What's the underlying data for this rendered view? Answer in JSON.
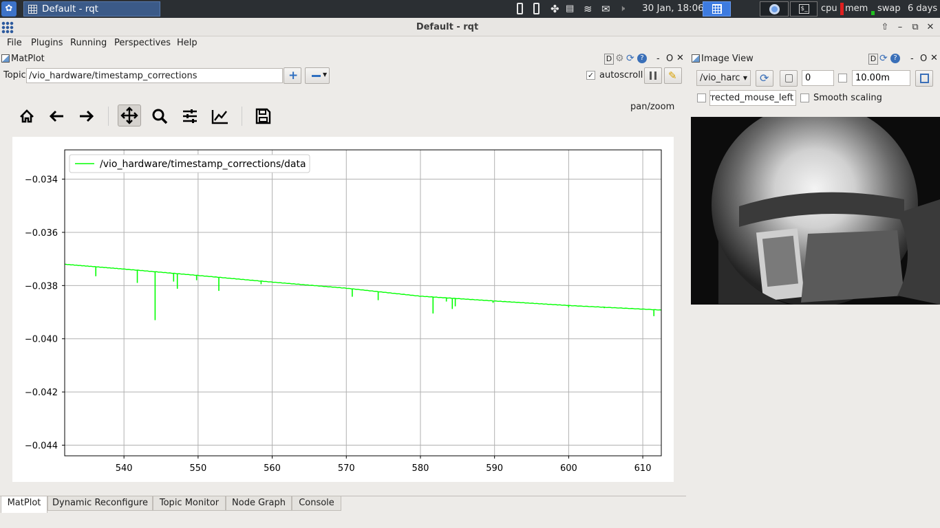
{
  "taskbar": {
    "window_title": "Default - rqt",
    "clock": "30 Jan, 18:06",
    "cpu_label": "cpu",
    "mem_label": "mem",
    "swap_label": "swap",
    "uptime": "6 days"
  },
  "window": {
    "title": "Default - rqt"
  },
  "menu": {
    "file": "File",
    "plugins": "Plugins",
    "running": "Running",
    "perspectives": "Perspectives",
    "help": "Help"
  },
  "matplot": {
    "panel_title": "MatPlot",
    "dock_d": "D",
    "dock_dash": "-",
    "dock_o": "O",
    "topic_label": "Topic",
    "topic_value": "/vio_hardware/timestamp_corrections",
    "autoscroll_label": "autoscroll",
    "autoscroll_checked": true,
    "mode_label": "pan/zoom"
  },
  "image_view": {
    "panel_title": "Image View",
    "dock_d": "D",
    "dock_dash": "-",
    "dock_o": "O",
    "topic_value": "/vio_harc",
    "spin_value": "0",
    "time_value": "10.00m",
    "overlay_value": "orrected_mouse_left",
    "smooth_label": "Smooth scaling"
  },
  "tabs": [
    "MatPlot",
    "Dynamic Reconfigure",
    "Topic Monitor",
    "Node Graph",
    "Console"
  ],
  "chart_data": {
    "type": "line",
    "title": "",
    "xlabel": "",
    "ylabel": "",
    "xlim": [
      532,
      612.5
    ],
    "ylim": [
      -0.0444,
      -0.0329
    ],
    "xticks": [
      540,
      550,
      560,
      570,
      580,
      590,
      600,
      610
    ],
    "xtick_labels": [
      "540",
      "550",
      "560",
      "570",
      "580",
      "590",
      "600",
      "610"
    ],
    "yticks": [
      -0.034,
      -0.036,
      -0.038,
      -0.04,
      -0.042,
      -0.044
    ],
    "ytick_labels": [
      "−0.034",
      "−0.036",
      "−0.038",
      "−0.040",
      "−0.042",
      "−0.044"
    ],
    "grid": true,
    "legend": "top-left",
    "series": [
      {
        "name": "/vio_hardware/timestamp_corrections/data",
        "color": "#00ff00",
        "x": [
          532,
          540,
          550,
          560,
          570,
          580,
          590,
          600,
          612.5
        ],
        "values": [
          -0.0372,
          -0.03738,
          -0.03762,
          -0.03787,
          -0.0381,
          -0.0384,
          -0.03858,
          -0.03875,
          -0.03892
        ],
        "spikes": [
          {
            "x": 536.2,
            "y": -0.03765
          },
          {
            "x": 541.8,
            "y": -0.0379
          },
          {
            "x": 544.2,
            "y": -0.0393
          },
          {
            "x": 546.7,
            "y": -0.03785
          },
          {
            "x": 547.2,
            "y": -0.03812
          },
          {
            "x": 549.8,
            "y": -0.0378
          },
          {
            "x": 552.8,
            "y": -0.0382
          },
          {
            "x": 558.5,
            "y": -0.03795
          },
          {
            "x": 570.8,
            "y": -0.03842
          },
          {
            "x": 574.3,
            "y": -0.03855
          },
          {
            "x": 581.7,
            "y": -0.03905
          },
          {
            "x": 583.5,
            "y": -0.0386
          },
          {
            "x": 584.3,
            "y": -0.03888
          },
          {
            "x": 584.7,
            "y": -0.03878
          },
          {
            "x": 589.8,
            "y": -0.03865
          },
          {
            "x": 593.0,
            "y": -0.03862
          },
          {
            "x": 600.0,
            "y": -0.03882
          },
          {
            "x": 604.8,
            "y": -0.03885
          },
          {
            "x": 611.5,
            "y": -0.03915
          }
        ]
      }
    ]
  },
  "colors": {
    "plot_line": "#00ff00",
    "grid": "#b0b0b0",
    "taskbar": "#2b2f33",
    "active_task": "#3b5a88",
    "cpu_meter": "#e02020",
    "mem_meter": "#20c020"
  }
}
